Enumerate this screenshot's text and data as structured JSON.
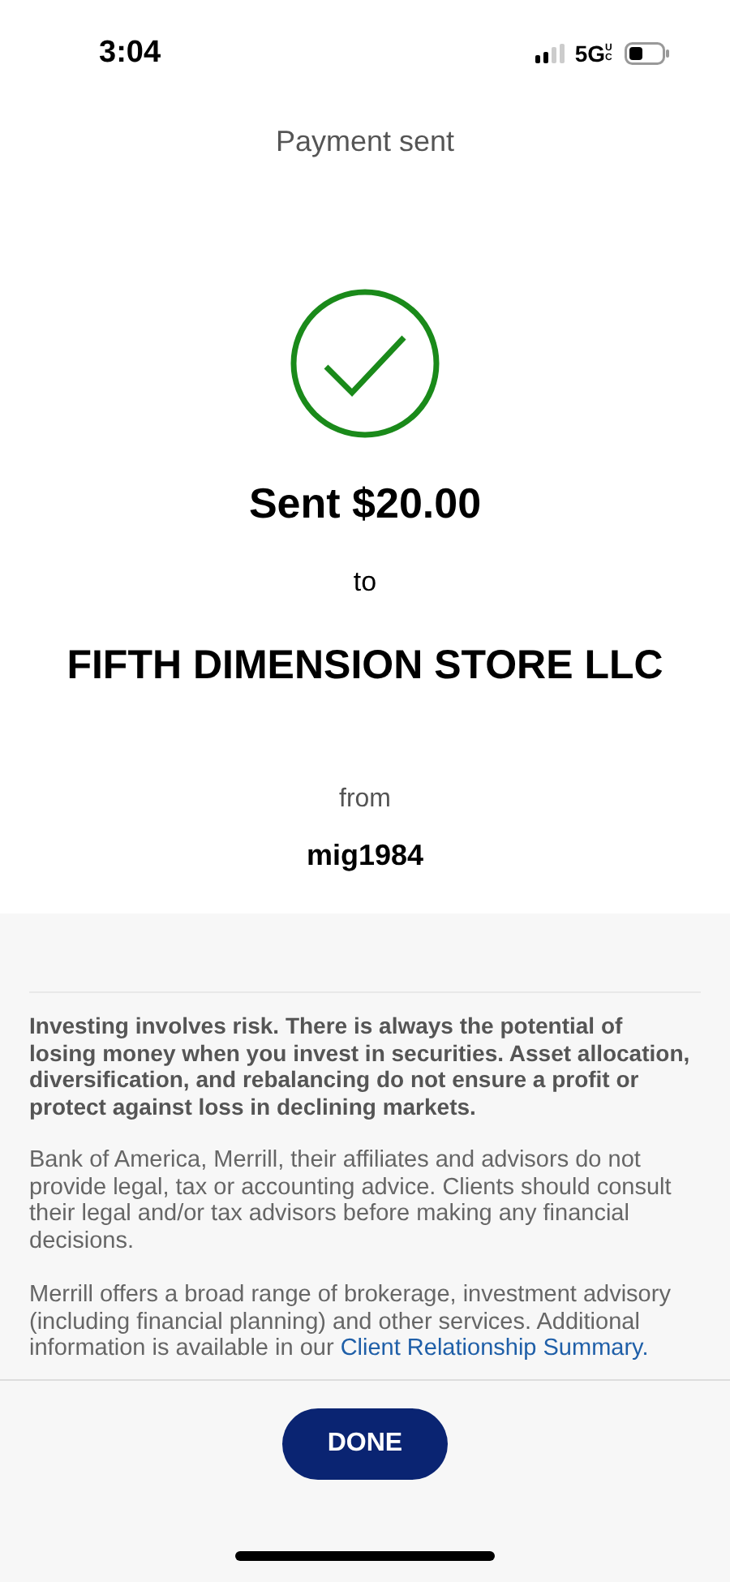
{
  "status_bar": {
    "time": "3:04",
    "network": "5G",
    "network_badge": "UC"
  },
  "header": {
    "title": "Payment sent"
  },
  "confirmation": {
    "headline": "Sent $20.00",
    "to_label": "to",
    "recipient": "FIFTH DIMENSION STORE LLC",
    "from_label": "from",
    "sender": "mig1984"
  },
  "disclosures": [
    {
      "kind": "emphasis",
      "text": "Investing involves risk. There is always the potential of losing money when you invest in securities. Asset allocation, diversification, and rebalancing do not ensure a profit or protect against loss in declining markets."
    },
    {
      "kind": "plain",
      "text": "Bank of America, Merrill, their affiliates and advisors do not provide legal, tax or accounting advice. Clients should consult their legal and/or tax advisors before making any financial decisions."
    },
    {
      "kind": "plain",
      "text": "Merrill offers a broad range of brokerage, investment advisory (including financial planning) and other services. Additional information is available in our ",
      "link": "Client Relationship Summary."
    }
  ],
  "buttons": [
    "DONE"
  ]
}
